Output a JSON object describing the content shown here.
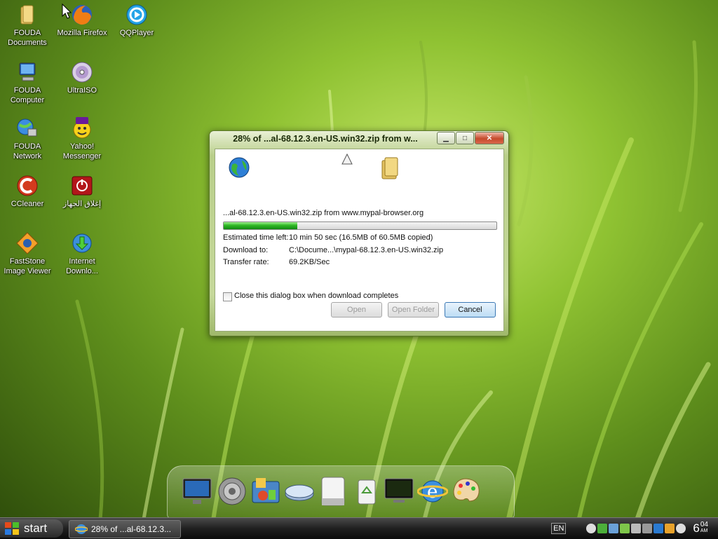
{
  "desktop": {
    "icons": [
      {
        "label": "FOUDA\nDocuments",
        "icon": "folder-icon"
      },
      {
        "label": "FOUDA\nComputer",
        "icon": "computer-icon"
      },
      {
        "label": "FOUDA\nNetwork",
        "icon": "network-icon"
      },
      {
        "label": "CCleaner",
        "icon": "ccleaner-icon"
      },
      {
        "label": "FastStone\nImage Viewer",
        "icon": "faststone-icon"
      },
      {
        "label": "Mozilla Firefox",
        "icon": "firefox-icon"
      },
      {
        "label": "UltraISO",
        "icon": "disc-icon"
      },
      {
        "label": "Yahoo!\nMessenger",
        "icon": "yahoo-messenger-icon"
      },
      {
        "label": "إغلاق الجهاز",
        "icon": "shutdown-icon"
      },
      {
        "label": "Internet\nDownlo...",
        "icon": "internet-download-manager-icon"
      },
      {
        "label": "QQPlayer",
        "icon": "qqplayer-icon"
      }
    ]
  },
  "dialog": {
    "title": "28% of ...al-68.12.3.en-US.win32.zip from w...",
    "source": "...al-68.12.3.en-US.win32.zip from www.mypal-browser.org",
    "progress": 0.27,
    "estimated_label": "Estimated time left:",
    "estimated_value": "10 min 50 sec (16.5MB of 60.5MB copied)",
    "download_to_label": "Download to:",
    "download_to_value": "C:\\Docume...\\mypal-68.12.3.en-US.win32.zip",
    "rate_label": "Transfer rate:",
    "rate_value": "69.2KB/Sec",
    "close_checkbox_label": "Close this dialog box when download completes",
    "buttons": {
      "open": "Open",
      "open_folder": "Open Folder",
      "cancel": "Cancel"
    }
  },
  "taskbar": {
    "start_label": "start",
    "task_label": "28% of ...al-68.12.3...",
    "language": "EN",
    "clock_hour": "6",
    "clock_min": "04",
    "clock_ampm": "AM"
  }
}
